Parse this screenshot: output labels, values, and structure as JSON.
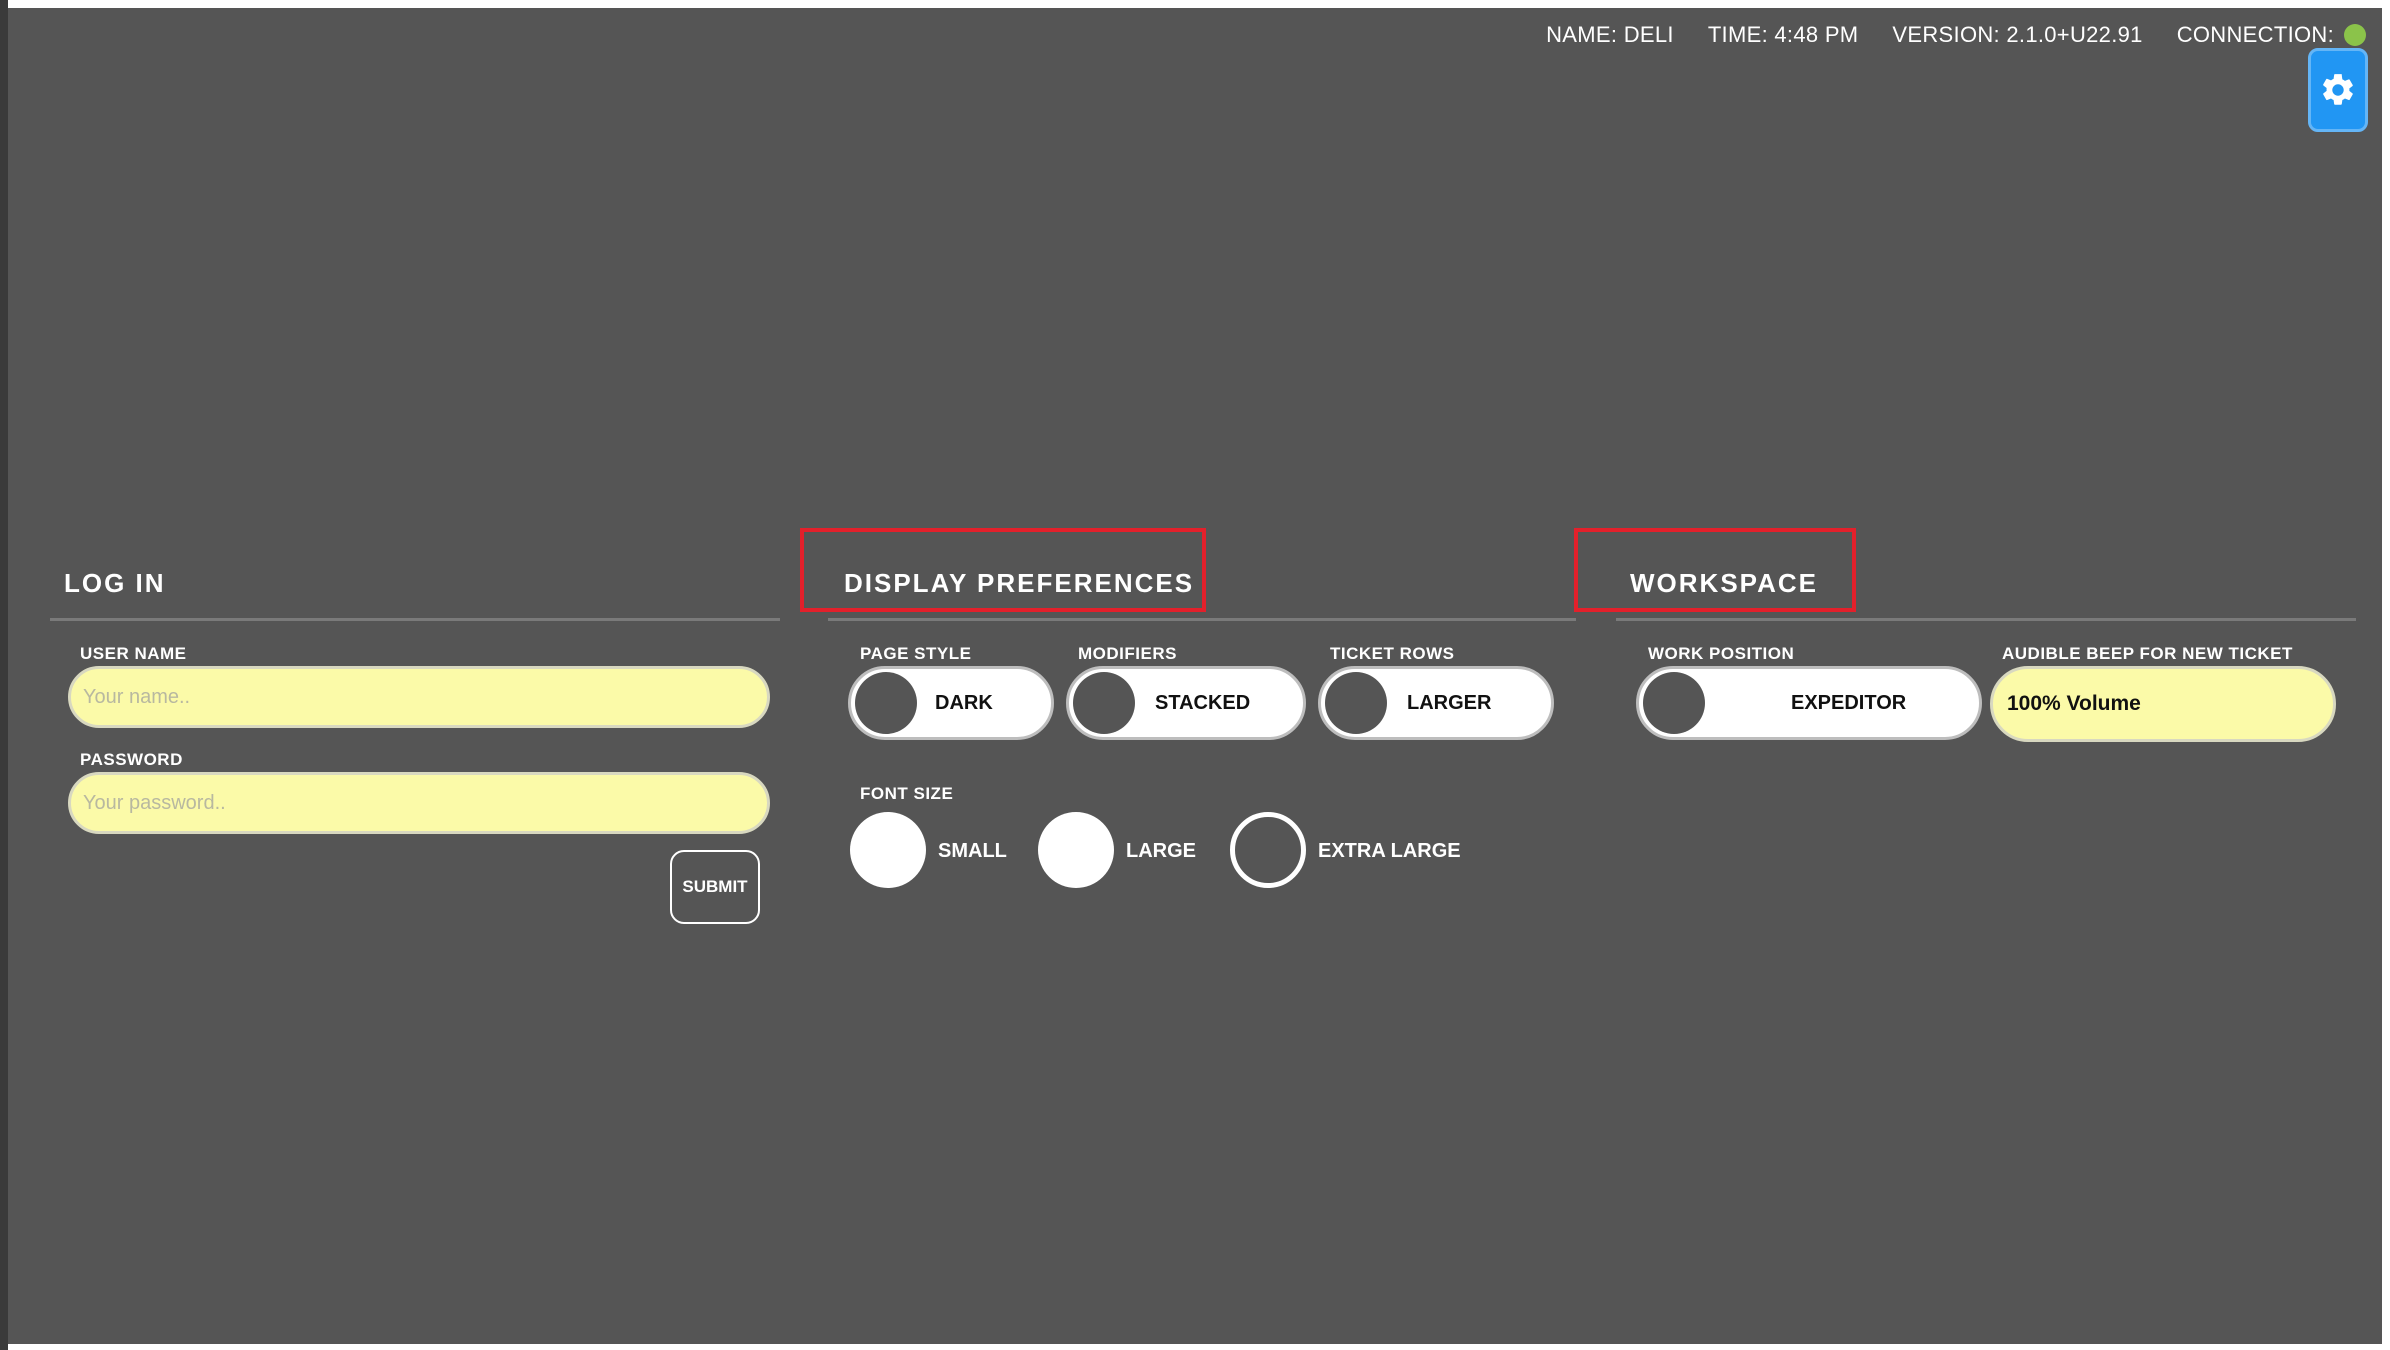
{
  "status": {
    "name": "NAME: DELI",
    "time": "TIME: 4:48 PM",
    "version": "VERSION: 2.1.0+U22.91",
    "connection": "CONNECTION:"
  },
  "colors": {
    "connection_ok": "#8bc34a",
    "settings_button": "#2196f3",
    "highlight": "#e3202b",
    "input_bg": "#fbfaa8"
  },
  "icons": {
    "settings": "gear-icon"
  },
  "login": {
    "title": "LOG IN",
    "username_label": "USER NAME",
    "username_placeholder": "Your name..",
    "password_label": "PASSWORD",
    "password_placeholder": "Your password..",
    "submit_label": "SUBMIT"
  },
  "display": {
    "title": "DISPLAY PREFERENCES",
    "page_style_label": "PAGE STYLE",
    "page_style_value": "DARK",
    "modifiers_label": "MODIFIERS",
    "modifiers_value": "STACKED",
    "ticket_rows_label": "TICKET ROWS",
    "ticket_rows_value": "LARGER",
    "font_size_label": "FONT SIZE",
    "font_options": [
      "SMALL",
      "LARGE",
      "EXTRA LARGE"
    ],
    "font_selected": "EXTRA LARGE"
  },
  "workspace": {
    "title": "WORKSPACE",
    "work_position_label": "WORK POSITION",
    "work_position_value": "EXPEDITOR",
    "beep_label": "AUDIBLE BEEP FOR NEW TICKET",
    "beep_value": "100% Volume"
  }
}
